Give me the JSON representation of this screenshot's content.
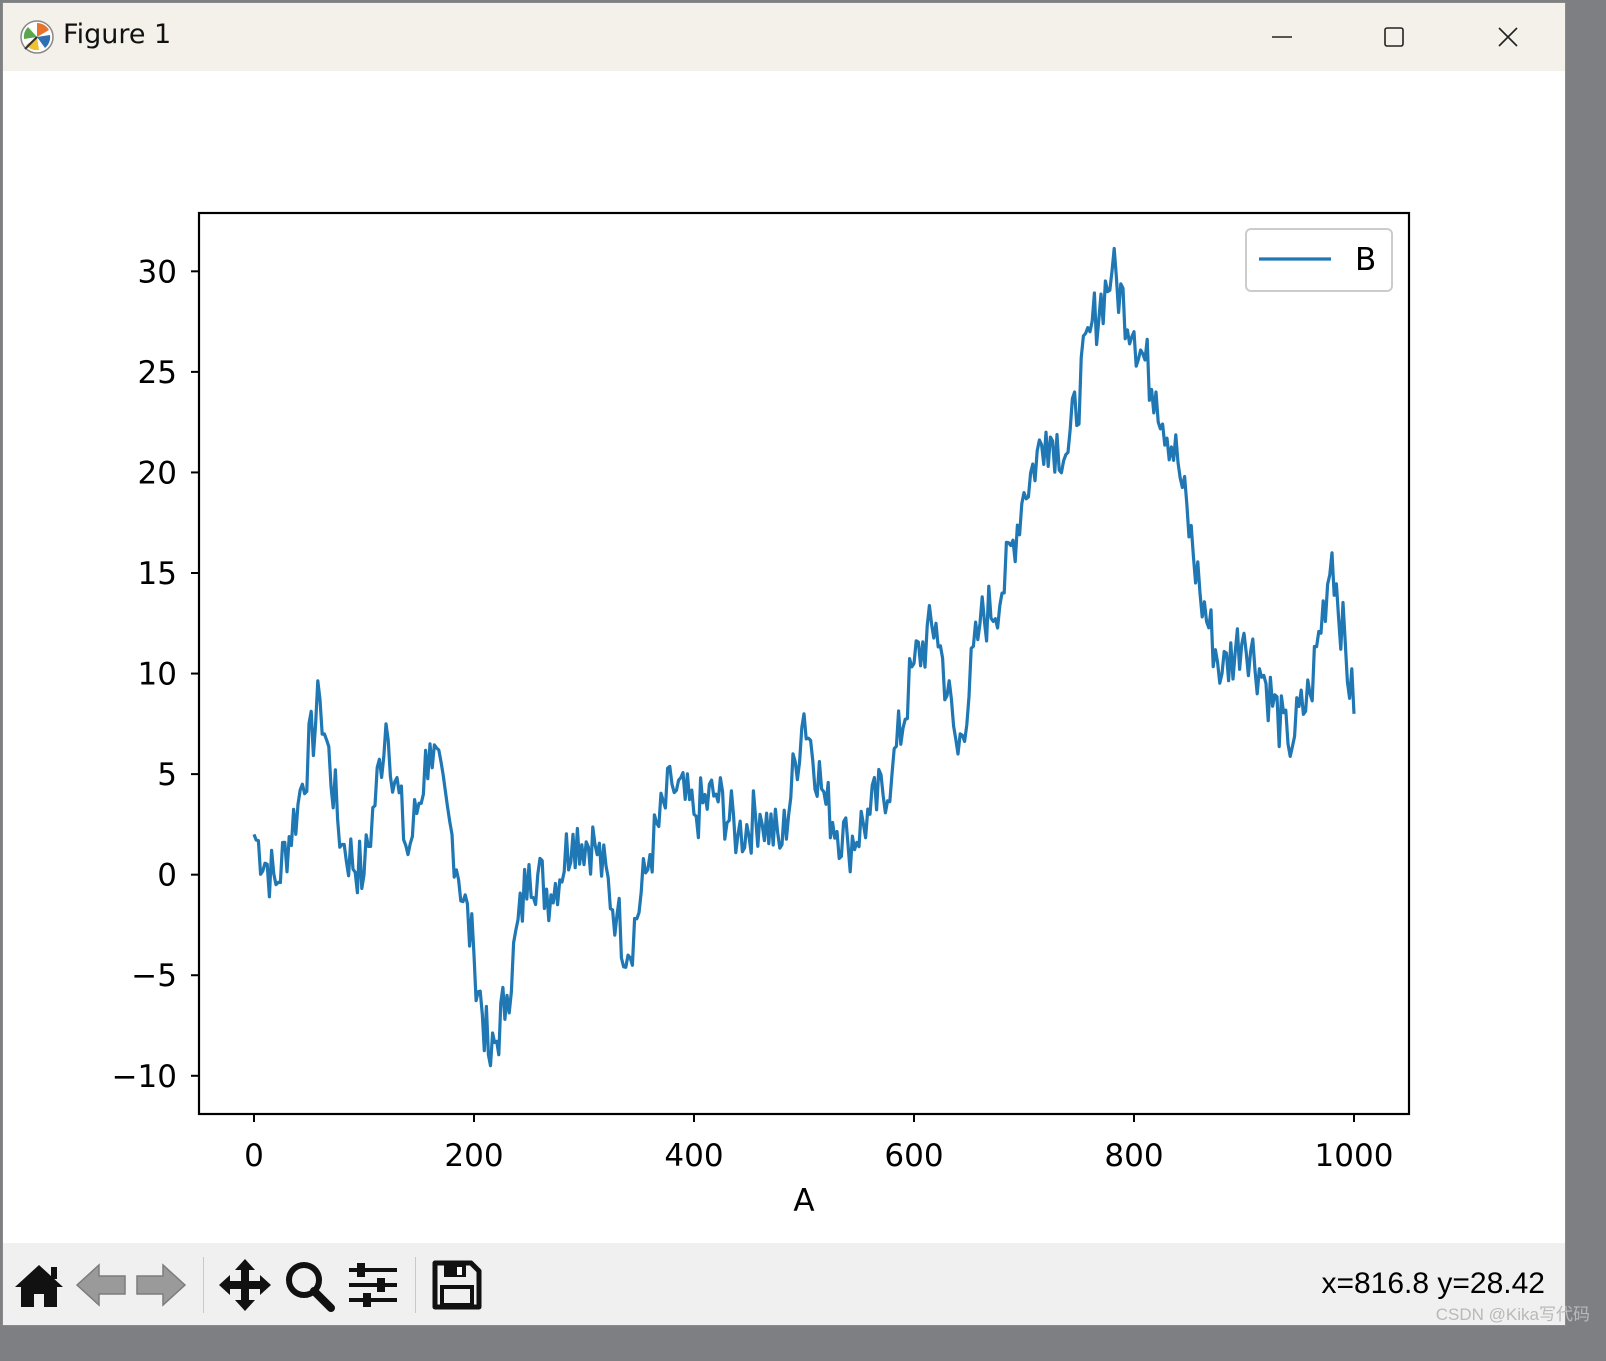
{
  "window": {
    "title": "Figure 1",
    "icons": {
      "app": "matplotlib-logo-icon",
      "minimize": "minimize-icon",
      "maximize": "maximize-icon",
      "close": "close-icon"
    }
  },
  "toolbar": {
    "buttons": [
      {
        "name": "home",
        "icon": "home-icon"
      },
      {
        "name": "back",
        "icon": "arrow-left-icon"
      },
      {
        "name": "forward",
        "icon": "arrow-right-icon"
      },
      {
        "name": "pan",
        "icon": "move-icon"
      },
      {
        "name": "zoom",
        "icon": "magnifier-icon"
      },
      {
        "name": "subplots",
        "icon": "sliders-icon"
      },
      {
        "name": "save",
        "icon": "floppy-disk-icon"
      }
    ],
    "coordinates": "x=816.8 y=28.42"
  },
  "watermark": "CSDN @Kika写代码",
  "chart_data": {
    "type": "line",
    "xlabel": "A",
    "ylabel": "",
    "xlim": [
      -50,
      1050
    ],
    "ylim": [
      -11.9,
      32.9
    ],
    "xticks": [
      0,
      200,
      400,
      600,
      800,
      1000
    ],
    "xtick_labels": [
      "0",
      "200",
      "400",
      "600",
      "800",
      "1000"
    ],
    "yticks": [
      -10,
      -5,
      0,
      5,
      10,
      15,
      20,
      25,
      30
    ],
    "ytick_labels": [
      "−10",
      "−5",
      "0",
      "5",
      "10",
      "15",
      "20",
      "25",
      "30"
    ],
    "grid": false,
    "legend": {
      "position": "top-right",
      "entries": [
        "B"
      ]
    },
    "series": [
      {
        "name": "B",
        "color": "#1f77b4",
        "x": [
          0,
          20,
          40,
          60,
          80,
          100,
          120,
          140,
          160,
          180,
          200,
          215,
          230,
          250,
          270,
          290,
          310,
          330,
          340,
          360,
          380,
          400,
          420,
          440,
          460,
          480,
          500,
          520,
          540,
          560,
          580,
          600,
          620,
          640,
          660,
          680,
          700,
          720,
          740,
          760,
          780,
          800,
          820,
          840,
          860,
          880,
          900,
          920,
          940,
          960,
          980,
          1000
        ],
        "y": [
          2,
          -0.5,
          3.5,
          8.7,
          1.5,
          0,
          7.5,
          1,
          6.5,
          2,
          -4,
          -9.5,
          -6,
          0.5,
          -1,
          2,
          1.5,
          -2,
          -4,
          1,
          4.5,
          3,
          4,
          2,
          3,
          1.5,
          8,
          3.5,
          1.5,
          3,
          5,
          10.5,
          12.5,
          6,
          12.5,
          14,
          19,
          22,
          21,
          27,
          30,
          27,
          24,
          20.5,
          14,
          10,
          12,
          9.5,
          6.5,
          9,
          16,
          8
        ]
      }
    ]
  }
}
